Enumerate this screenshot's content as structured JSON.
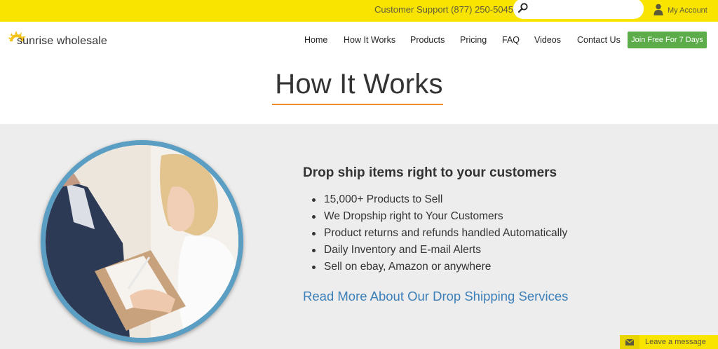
{
  "topbar": {
    "support_text": "Customer Support (877) 250-5045",
    "search_placeholder": "",
    "account_label": "My Account"
  },
  "header": {
    "logo_text": "sunrise wholesale",
    "nav": [
      "Home",
      "How It Works",
      "Products",
      "Pricing",
      "FAQ",
      "Videos",
      "Contact Us"
    ],
    "cta_label": "Join Free For 7 Days"
  },
  "page": {
    "title": "How It Works"
  },
  "feature": {
    "heading": "Drop ship items right to your customers",
    "bullets": [
      "15,000+ Products to Sell",
      "We Dropship right to Your Customers",
      "Product returns and refunds handled Automatically",
      "Daily Inventory and E-mail Alerts",
      "Sell on ebay, Amazon or anywhere"
    ],
    "read_more": "Read More About Our Drop Shipping Services"
  },
  "chat": {
    "label": "Leave a message"
  },
  "colors": {
    "topbar": "#f9e400",
    "accent_underline": "#f08c2a",
    "cta": "#5cad4a",
    "link": "#3c7fb8",
    "ring": "#5b9ec4",
    "band": "#ededed"
  }
}
